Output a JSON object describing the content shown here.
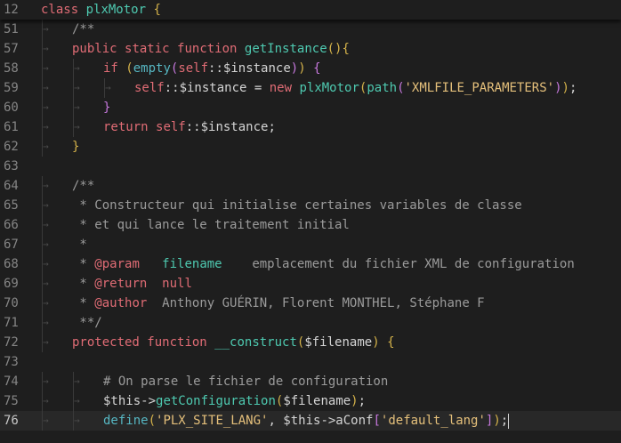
{
  "sticky": {
    "number": "12",
    "text": "class plxMotor {",
    "kw": "class",
    "name": "plxMotor",
    "brace": "{"
  },
  "lines": [
    {
      "n": "51",
      "indent": 1,
      "tokens": [
        {
          "c": "cmt",
          "t": "/**"
        }
      ]
    },
    {
      "n": "57",
      "indent": 1,
      "tokens": [
        {
          "c": "kw",
          "t": "public"
        },
        {
          "c": "t",
          "t": " "
        },
        {
          "c": "kw",
          "t": "static"
        },
        {
          "c": "t",
          "t": " "
        },
        {
          "c": "kw",
          "t": "function"
        },
        {
          "c": "t",
          "t": " "
        },
        {
          "c": "fn",
          "t": "getInstance"
        },
        {
          "c": "paren",
          "t": "()"
        },
        {
          "c": "paren",
          "t": "{"
        }
      ]
    },
    {
      "n": "58",
      "indent": 2,
      "tokens": [
        {
          "c": "kw",
          "t": "if"
        },
        {
          "c": "t",
          "t": " "
        },
        {
          "c": "paren",
          "t": "("
        },
        {
          "c": "fn2",
          "t": "empty"
        },
        {
          "c": "paren2",
          "t": "("
        },
        {
          "c": "kw",
          "t": "self"
        },
        {
          "c": "t",
          "t": "::$instance"
        },
        {
          "c": "paren2",
          "t": ")"
        },
        {
          "c": "paren",
          "t": ")"
        },
        {
          "c": "t",
          "t": " "
        },
        {
          "c": "paren2",
          "t": "{"
        }
      ]
    },
    {
      "n": "59",
      "indent": 3,
      "tokens": [
        {
          "c": "kw",
          "t": "self"
        },
        {
          "c": "t",
          "t": "::$instance = "
        },
        {
          "c": "kw",
          "t": "new"
        },
        {
          "c": "t",
          "t": " "
        },
        {
          "c": "fn",
          "t": "plxMotor"
        },
        {
          "c": "paren",
          "t": "("
        },
        {
          "c": "fn",
          "t": "path"
        },
        {
          "c": "paren2",
          "t": "("
        },
        {
          "c": "str",
          "t": "'XMLFILE_PARAMETERS'"
        },
        {
          "c": "paren2",
          "t": ")"
        },
        {
          "c": "paren",
          "t": ")"
        },
        {
          "c": "t",
          "t": ";"
        }
      ]
    },
    {
      "n": "60",
      "indent": 2,
      "tokens": [
        {
          "c": "paren2",
          "t": "}"
        }
      ]
    },
    {
      "n": "61",
      "indent": 2,
      "tokens": [
        {
          "c": "kw",
          "t": "return"
        },
        {
          "c": "t",
          "t": " "
        },
        {
          "c": "kw",
          "t": "self"
        },
        {
          "c": "t",
          "t": "::$instance;"
        }
      ]
    },
    {
      "n": "62",
      "indent": 1,
      "tokens": [
        {
          "c": "paren",
          "t": "}"
        }
      ]
    },
    {
      "n": "63",
      "indent": 0,
      "tokens": []
    },
    {
      "n": "64",
      "indent": 1,
      "tokens": [
        {
          "c": "cmt",
          "t": "/**"
        }
      ]
    },
    {
      "n": "65",
      "indent": 1,
      "tokens": [
        {
          "c": "cmt",
          "t": " * Constructeur qui initialise certaines variables de classe"
        }
      ]
    },
    {
      "n": "66",
      "indent": 1,
      "tokens": [
        {
          "c": "cmt",
          "t": " * et qui lance le traitement initial"
        }
      ]
    },
    {
      "n": "67",
      "indent": 1,
      "tokens": [
        {
          "c": "cmt",
          "t": " *"
        }
      ]
    },
    {
      "n": "68",
      "indent": 1,
      "tokens": [
        {
          "c": "cmt",
          "t": " * "
        },
        {
          "c": "tag",
          "t": "@param"
        },
        {
          "c": "cmt",
          "t": "   "
        },
        {
          "c": "tagval",
          "t": "filename"
        },
        {
          "c": "cmt",
          "t": "    emplacement du fichier XML de configuration"
        }
      ]
    },
    {
      "n": "69",
      "indent": 1,
      "tokens": [
        {
          "c": "cmt",
          "t": " * "
        },
        {
          "c": "tag",
          "t": "@return"
        },
        {
          "c": "cmt",
          "t": "  "
        },
        {
          "c": "tag",
          "t": "null"
        }
      ]
    },
    {
      "n": "70",
      "indent": 1,
      "tokens": [
        {
          "c": "cmt",
          "t": " * "
        },
        {
          "c": "tag",
          "t": "@author"
        },
        {
          "c": "cmt",
          "t": "  Anthony GUÉRIN, Florent MONTHEL, Stéphane F"
        }
      ]
    },
    {
      "n": "71",
      "indent": 1,
      "tokens": [
        {
          "c": "cmt",
          "t": " **/"
        }
      ]
    },
    {
      "n": "72",
      "indent": 1,
      "tokens": [
        {
          "c": "kw",
          "t": "protected"
        },
        {
          "c": "t",
          "t": " "
        },
        {
          "c": "kw",
          "t": "function"
        },
        {
          "c": "t",
          "t": " "
        },
        {
          "c": "fn",
          "t": "__construct"
        },
        {
          "c": "paren",
          "t": "("
        },
        {
          "c": "t",
          "t": "$filename"
        },
        {
          "c": "paren",
          "t": ")"
        },
        {
          "c": "t",
          "t": " "
        },
        {
          "c": "paren",
          "t": "{"
        }
      ]
    },
    {
      "n": "73",
      "indent": 0,
      "tokens": []
    },
    {
      "n": "74",
      "indent": 2,
      "tokens": [
        {
          "c": "cmt",
          "t": "# On parse le fichier de configuration"
        }
      ]
    },
    {
      "n": "75",
      "indent": 2,
      "tokens": [
        {
          "c": "t",
          "t": "$this->"
        },
        {
          "c": "fn",
          "t": "getConfiguration"
        },
        {
          "c": "paren",
          "t": "("
        },
        {
          "c": "t",
          "t": "$filename"
        },
        {
          "c": "paren",
          "t": ")"
        },
        {
          "c": "t",
          "t": ";"
        }
      ]
    },
    {
      "n": "76",
      "indent": 2,
      "current": true,
      "tokens": [
        {
          "c": "fn2",
          "t": "define"
        },
        {
          "c": "paren",
          "t": "("
        },
        {
          "c": "str",
          "t": "'PLX_SITE_LANG'"
        },
        {
          "c": "t",
          "t": ", $this->aConf"
        },
        {
          "c": "paren2",
          "t": "["
        },
        {
          "c": "str",
          "t": "'default_lang'"
        },
        {
          "c": "paren2",
          "t": "]"
        },
        {
          "c": "paren",
          "t": ")"
        },
        {
          "c": "t",
          "t": ";"
        }
      ]
    }
  ]
}
